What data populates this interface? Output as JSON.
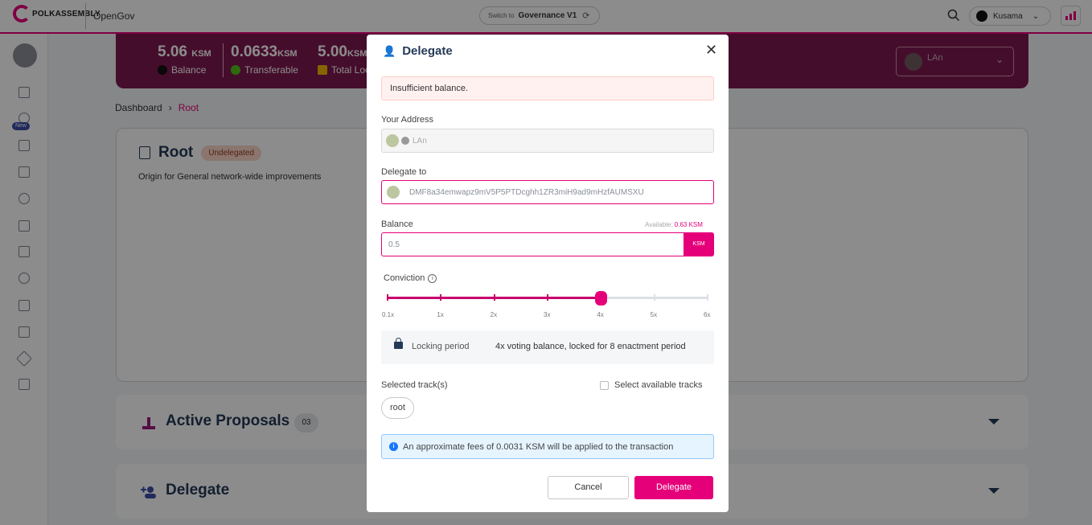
{
  "topbar": {
    "logo_text": "POLKASSEMBLY",
    "opengov": "OpenGov",
    "switch_prefix": "Switch to",
    "switch_target": "Governance V1",
    "network": "Kusama"
  },
  "sidebar": {
    "new_badge": "New"
  },
  "balances": [
    {
      "value": "5.06",
      "unit": "KSM",
      "label": "Balance"
    },
    {
      "value": "0.0633",
      "unit": "KSM",
      "label": "Transferable"
    },
    {
      "value": "5.00",
      "unit": "KSM",
      "label": "Total Loc"
    }
  ],
  "account_select": {
    "name": "LAn"
  },
  "breadcrumb": {
    "root": "Dashboard",
    "current": "Root"
  },
  "track": {
    "title": "Root",
    "status": "Undelegated",
    "description": "Origin for General network-wide improvements"
  },
  "sections": {
    "active_proposals": {
      "title": "Active Proposals",
      "count": "03"
    },
    "delegate": {
      "title": "Delegate"
    }
  },
  "modal": {
    "title": "Delegate",
    "error": "Insufficient balance.",
    "your_address_label": "Your Address",
    "your_address_name": "LAn",
    "delegate_to_label": "Delegate to",
    "delegate_to_value": "DMF8a34emwapz9mV5P5PTDcghh1ZR3miH9ad9mHzfAUMSXU",
    "balance_label": "Balance",
    "available_prefix": "Available:",
    "available_value": "0.63 KSM",
    "balance_value": "0.5",
    "balance_unit": "KSM",
    "conviction_label": "Conviction",
    "conviction_ticks": [
      "0.1x",
      "1x",
      "2x",
      "3x",
      "4x",
      "5x",
      "6x"
    ],
    "conviction_selected_index": 4,
    "locking_label": "Locking period",
    "locking_value": "4x voting balance, locked for 8 enactment period",
    "selected_tracks_label": "Selected track(s)",
    "select_available_label": "Select available tracks",
    "tracks": [
      "root"
    ],
    "fee_text": "An approximate fees of 0.0031 KSM will be applied to the transaction",
    "cancel_label": "Cancel",
    "delegate_label": "Delegate"
  },
  "colors": {
    "accent": "#e5007a",
    "header_bg": "#7e1850"
  }
}
